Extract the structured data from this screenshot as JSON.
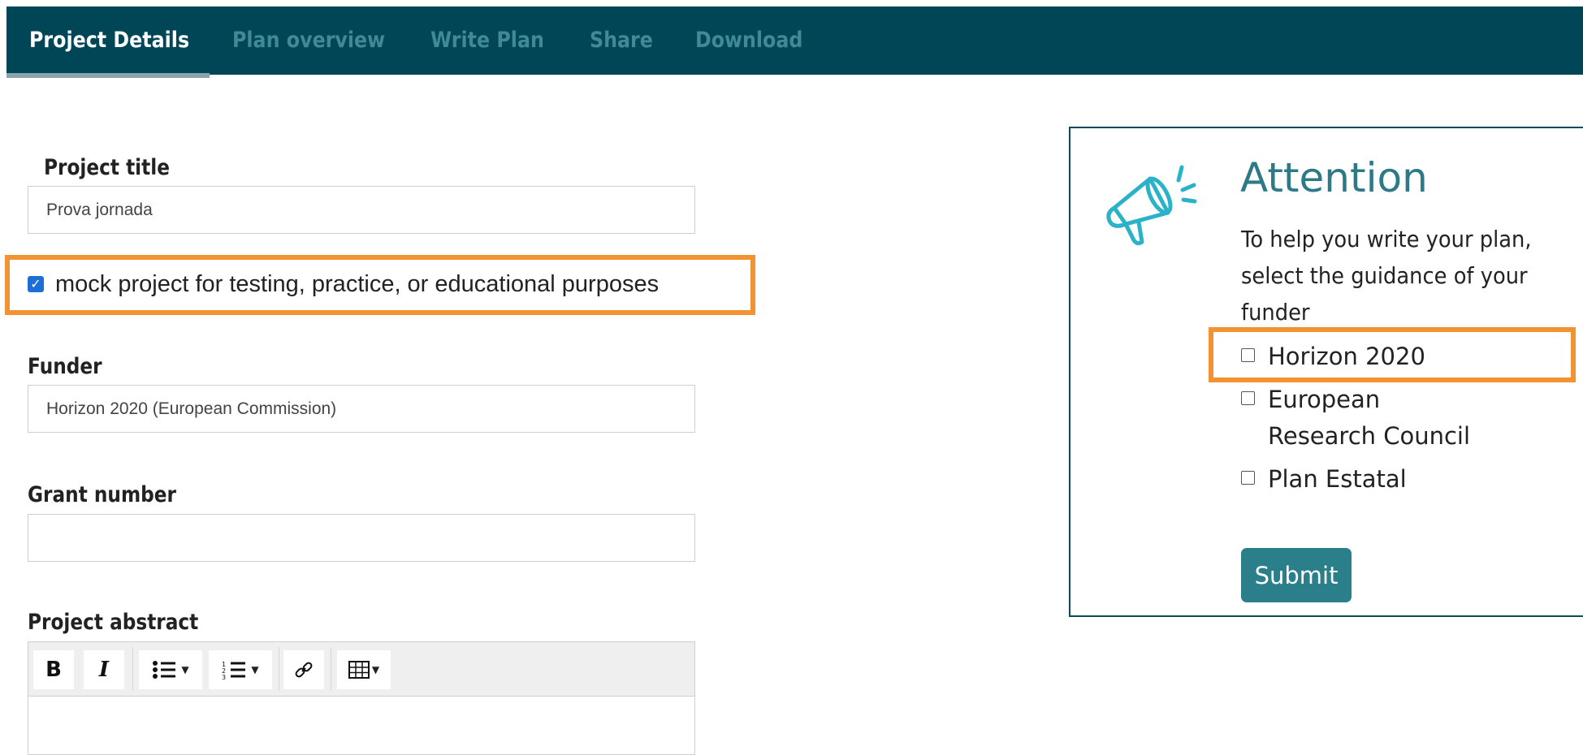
{
  "nav": {
    "tabs": [
      {
        "label": "Project Details",
        "active": true
      },
      {
        "label": "Plan overview",
        "active": false
      },
      {
        "label": "Write Plan",
        "active": false
      },
      {
        "label": "Share",
        "active": false
      },
      {
        "label": "Download",
        "active": false
      }
    ]
  },
  "form": {
    "project_title": {
      "label": "Project title",
      "value": "Prova jornada"
    },
    "mock_project": {
      "label": "mock project for testing, practice, or educational purposes",
      "checked": true
    },
    "funder": {
      "label": "Funder",
      "value": "Horizon 2020 (European Commission)"
    },
    "grant_number": {
      "label": "Grant number",
      "value": ""
    },
    "abstract": {
      "label": "Project abstract",
      "toolbar": [
        "bold",
        "italic",
        "bulleted-list",
        "numbered-list",
        "link",
        "table"
      ],
      "value": ""
    }
  },
  "attention": {
    "icon": "megaphone-icon",
    "title": "Attention",
    "text": "To help you write your plan, select the guidance of your funder",
    "options": [
      {
        "label": "Horizon 2020",
        "checked": false
      },
      {
        "label": "European Research Council",
        "checked": false
      },
      {
        "label": "Plan Estatal",
        "checked": false
      }
    ],
    "submit_label": "Submit"
  },
  "colors": {
    "nav_bg": "#014657",
    "nav_inactive": "#3f8a96",
    "accent": "#2b7f8b",
    "highlight": "#f39232"
  }
}
